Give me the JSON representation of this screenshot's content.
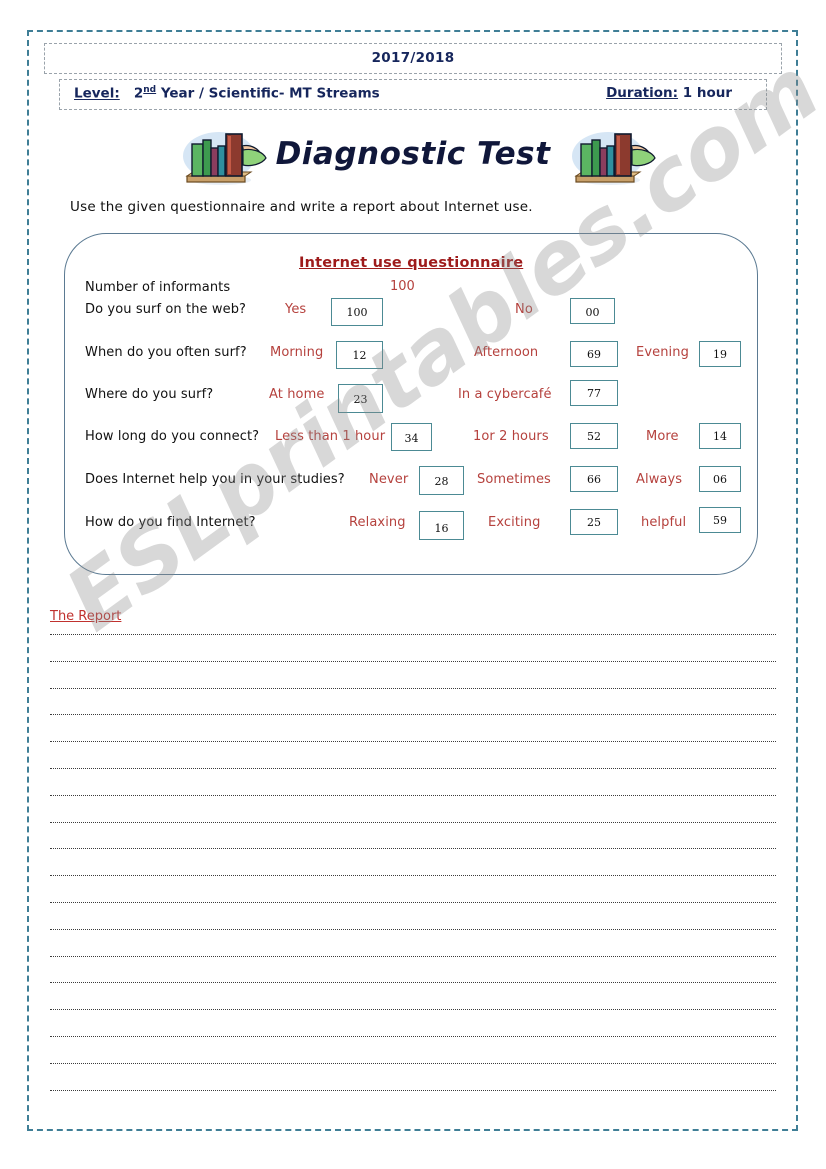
{
  "header": {
    "year": "2017/2018",
    "level_label": "Level:",
    "level_value": "2",
    "level_sup": "nd",
    "level_rest": " Year / Scientific- MT Streams",
    "duration_label": "Duration:",
    "duration_value": "1 hour"
  },
  "title": {
    "text": "Diagnostic Test",
    "clipart_left": "books-and-hand-clipart",
    "clipart_right": "books-and-hand-clipart"
  },
  "instruction": "Use the given questionnaire and write a report about Internet use.",
  "questionnaire": {
    "title": "Internet use questionnaire",
    "informants_label": "Number of informants",
    "informants_value": "100",
    "rows": [
      {
        "question": "Do you surf on the web?",
        "options": [
          {
            "label": "Yes",
            "value": "100"
          },
          {
            "label": "No",
            "value": "00"
          }
        ]
      },
      {
        "question": "When do you often surf?",
        "options": [
          {
            "label": "Morning",
            "value": "12"
          },
          {
            "label": "Afternoon",
            "value": "69"
          },
          {
            "label": "Evening",
            "value": "19"
          }
        ]
      },
      {
        "question": "Where do you surf?",
        "options": [
          {
            "label": "At home",
            "value": "23"
          },
          {
            "label": "In a cybercafé",
            "value": "77"
          }
        ]
      },
      {
        "question": "How long do you connect?",
        "options": [
          {
            "label": "Less than 1 hour",
            "value": "34"
          },
          {
            "label": "1or 2 hours",
            "value": "52"
          },
          {
            "label": "More",
            "value": "14"
          }
        ]
      },
      {
        "question": "Does Internet help you in your studies?",
        "options": [
          {
            "label": "Never",
            "value": "28"
          },
          {
            "label": "Sometimes",
            "value": "66"
          },
          {
            "label": "Always",
            "value": "06"
          }
        ]
      },
      {
        "question": "How do you find Internet?",
        "options": [
          {
            "label": "Relaxing",
            "value": "16"
          },
          {
            "label": "Exciting",
            "value": "25"
          },
          {
            "label": "helpful",
            "value": "59"
          }
        ]
      }
    ]
  },
  "report": {
    "title": "The Report",
    "line_count": 18
  },
  "watermark": "ESLprintables.com",
  "colors": {
    "page_border": "#3f7e96",
    "header_text": "#16265c",
    "option_red": "#b5413d",
    "title_red": "#9e1b1b",
    "report_red": "#c0312e",
    "panel_border": "#5b7a92",
    "answer_box_border": "#4c8a94"
  }
}
